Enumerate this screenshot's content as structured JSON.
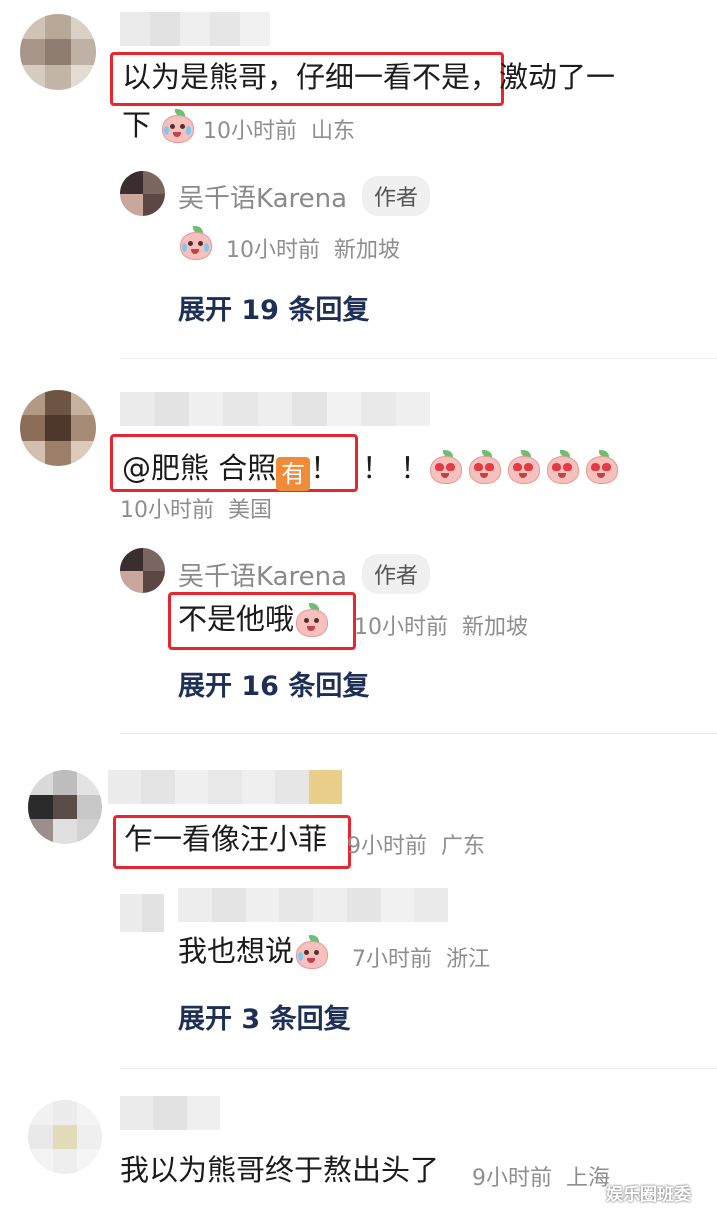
{
  "comments": [
    {
      "text_highlighted": "以为是熊哥，仔细一看不是",
      "text_rest": "，激动了一",
      "text_line2": "下",
      "time": "10小时前",
      "location": "山东",
      "reply": {
        "author": "吴千语Karena",
        "badge": "作者",
        "time": "10小时前",
        "location": "新加坡"
      },
      "expand": "展开 19 条回复"
    },
    {
      "text_prefix": "@肥熊  合照",
      "badge_char": "有",
      "text_suffix": "！",
      "text_after": "！ ！",
      "time": "10小时前",
      "location": "美国",
      "reply": {
        "author": "吴千语Karena",
        "badge": "作者",
        "text": "不是他哦",
        "time": "10小时前",
        "location": "新加坡"
      },
      "expand": "展开 16 条回复"
    },
    {
      "text": "乍一看像汪小菲",
      "time": "9小时前",
      "location": "广东",
      "reply": {
        "text": "我也想说",
        "time": "7小时前",
        "location": "浙江"
      },
      "expand": "展开 3 条回复"
    },
    {
      "text": "我以为熊哥终于熬出头了",
      "time": "9小时前",
      "location": "上海"
    }
  ],
  "watermark": "娱乐圈班委",
  "icons": {
    "emoji_cry": "peach-cry-emoji-icon",
    "emoji_heart_eyes": "peach-heart-eyes-emoji-icon",
    "emoji_shy": "peach-shy-emoji-icon",
    "emoji_wail": "peach-wail-emoji-icon"
  },
  "colors": {
    "highlight_border": "#e8262f",
    "expand_link": "#1e2f57",
    "meta_text": "#8e8e8e"
  }
}
